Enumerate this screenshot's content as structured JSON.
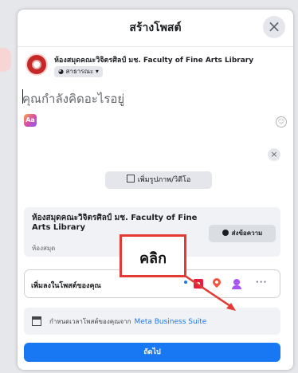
{
  "dialog": {
    "title": "สร้างโพสต์",
    "close_glyph": "×"
  },
  "account": {
    "name": "ห้องสมุดคณะวิจิตรศิลป์ มช. Faculty of Fine Arts Library",
    "privacy": "◕ สาธารณะ ▾"
  },
  "composer": {
    "placeholder": "คุณกำลังคิดอะไรอยู่",
    "aa_label": "Aa",
    "emoji_glyph": "☺"
  },
  "media": {
    "close_glyph": "×",
    "add_label": "เพิ่มรูปภาพ/วิดีโอ"
  },
  "page_card": {
    "name": "ห้องสมุดคณะวิจิตรศิลป์ มช. Faculty of Fine Arts Library",
    "category": "ห้องสมุด",
    "message_button": "ส่งข้อความ"
  },
  "add_to_post": {
    "label": "เพิ่มลงในโพสต์ของคุณ",
    "more_glyph": "···"
  },
  "schedule": {
    "text": "กำหนดเวลาโพสต์ของคุณจาก",
    "link": "Meta Business Suite"
  },
  "next_button": "ถัดไป",
  "callout": {
    "text": "คลิก",
    "color": "#e53935"
  },
  "colors": {
    "accent": "#1877f2",
    "callout_red": "#e53935"
  }
}
